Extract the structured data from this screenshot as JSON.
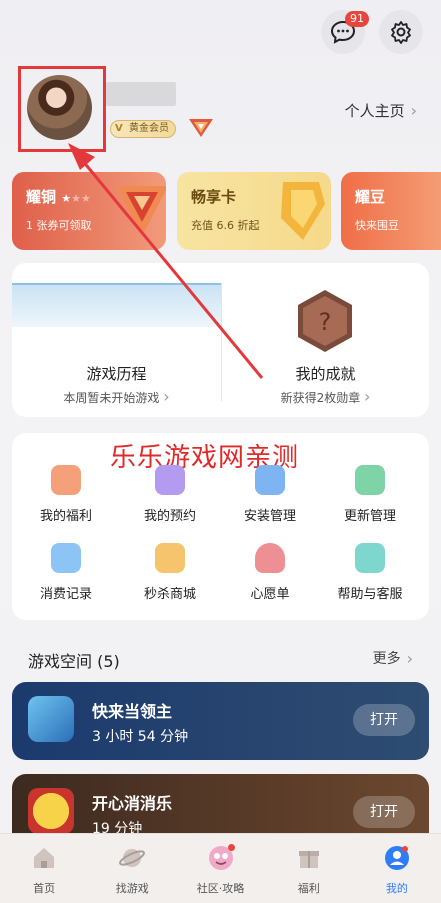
{
  "header": {
    "message_badge": "91"
  },
  "profile": {
    "member_label": "黄金会员",
    "homepage_link": "个人主页"
  },
  "cards": [
    {
      "title": "耀铜",
      "subtitle": "1 张券可领取"
    },
    {
      "title": "畅享卡",
      "subtitle": "充值 6.6 折起"
    },
    {
      "title": "耀豆",
      "subtitle": "快来围豆"
    }
  ],
  "history": {
    "title": "游戏历程",
    "subtitle": "本周暂未开始游戏"
  },
  "achievement": {
    "title": "我的成就",
    "subtitle": "新获得2枚勋章"
  },
  "watermark": "乐乐游戏网亲测",
  "grid": [
    {
      "label": "我的福利",
      "icon": "gift-icon",
      "color": "#f4a07a"
    },
    {
      "label": "我的预约",
      "icon": "calendar-icon",
      "color": "#b39cf0"
    },
    {
      "label": "安装管理",
      "icon": "download-icon",
      "color": "#7fb4f2"
    },
    {
      "label": "更新管理",
      "icon": "update-icon",
      "color": "#7ed4a6"
    },
    {
      "label": "消费记录",
      "icon": "wallet-icon",
      "color": "#8cc4f5"
    },
    {
      "label": "秒杀商城",
      "icon": "flash-bag-icon",
      "color": "#f5c46c"
    },
    {
      "label": "心愿单",
      "icon": "heart-icon",
      "color": "#ee8f94"
    },
    {
      "label": "帮助与客服",
      "icon": "support-icon",
      "color": "#7ed7cf"
    }
  ],
  "game_space": {
    "title": "游戏空间 (5)",
    "more": "更多",
    "games": [
      {
        "name": "快来当领主",
        "time": "3 小时 54 分钟",
        "button": "打开"
      },
      {
        "name": "开心消消乐",
        "time": "19 分钟",
        "button": "打开"
      }
    ]
  },
  "nav": [
    {
      "label": "首页",
      "icon": "home-icon"
    },
    {
      "label": "找游戏",
      "icon": "planet-icon"
    },
    {
      "label": "社区·攻略",
      "icon": "community-icon"
    },
    {
      "label": "福利",
      "icon": "gift-box-icon"
    },
    {
      "label": "我的",
      "icon": "profile-icon"
    }
  ]
}
